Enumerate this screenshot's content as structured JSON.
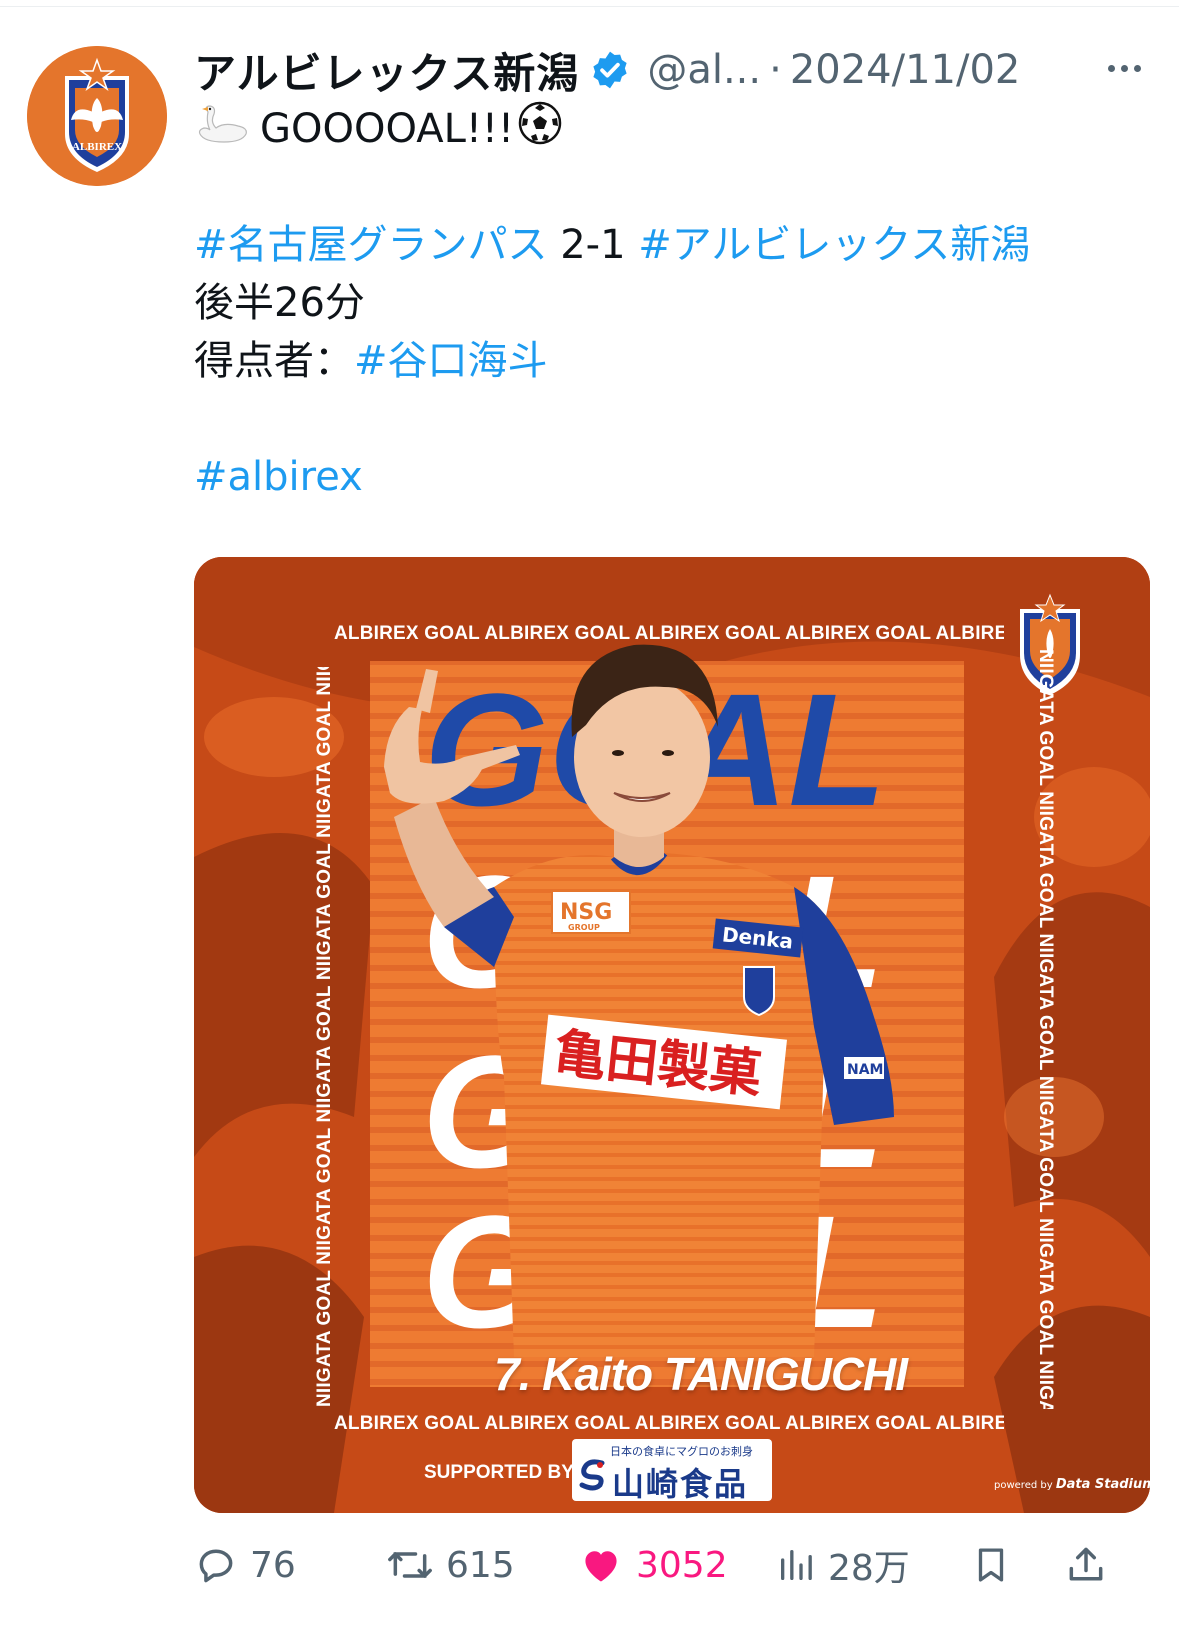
{
  "colors": {
    "link": "#1d9bf0",
    "like": "#f91880",
    "secondary": "#536471",
    "brand_orange": "#e4752c",
    "brand_blue": "#1f3f9c"
  },
  "account": {
    "display_name": "アルビレックス新潟",
    "handle": "@al...",
    "separator": "·",
    "date": "2024/11/02",
    "verified_icon": "verified-badge-icon",
    "avatar_crest_text": "ALBIREX"
  },
  "tweet": {
    "line1": "GOOOOAL!!!",
    "line1_leading_emoji": "swan-icon",
    "line1_trailing_emoji": "soccer-ball-icon",
    "hashtag_home": "#名古屋グランパス",
    "score": " 2-1 ",
    "hashtag_away": "#アルビレックス新潟",
    "time": "後半26分",
    "scorer_label": "得点者：",
    "hashtag_scorer": "#谷口海斗",
    "hashtag_tag": "#albirex"
  },
  "media": {
    "band_top": "ALBIREX GOAL ALBIREX GOAL ALBIREX GOAL ALBIREX GOAL ALBIREX GO",
    "band_bottom": "ALBIREX GOAL ALBIREX GOAL ALBIREX GOAL ALBIREX GOAL ALBIREX GO",
    "band_left": "NIIGATA GOAL NIIGATA GOAL NIIGATA GOAL NIIGATA GOAL NIIGATA GOAL NIIGATA",
    "band_right": "NIIGATA GOAL NIIGATA GOAL NIIGATA GOAL NIIGATA GOAL NIIGATA GOAL NIIGATA",
    "big_word": "GOAL",
    "player_name": "7. Kaito TANIGUCHI",
    "shirt_sponsor_chest": "亀田製菓",
    "shirt_sponsor_shoulder": "NSG",
    "shirt_sponsor_shoulder_sub": "GROUP",
    "shirt_sponsor_right": "Denka",
    "sleeve_logo": "NAMI",
    "supported_by": "SUPPORTED BY",
    "sponsor_tagline": "日本の食卓にマグロのお刺身",
    "sponsor_name": "山崎食品",
    "powered_by": "powered by",
    "powered_brand": "Data Stadium"
  },
  "actions": {
    "reply": {
      "icon": "reply-icon",
      "count": "76"
    },
    "retweet": {
      "icon": "retweet-icon",
      "count": "615"
    },
    "like": {
      "icon": "heart-icon",
      "count": "3052",
      "liked": true
    },
    "views": {
      "icon": "views-icon",
      "count": "28万"
    },
    "bookmark": {
      "icon": "bookmark-icon"
    },
    "share": {
      "icon": "share-icon"
    }
  }
}
